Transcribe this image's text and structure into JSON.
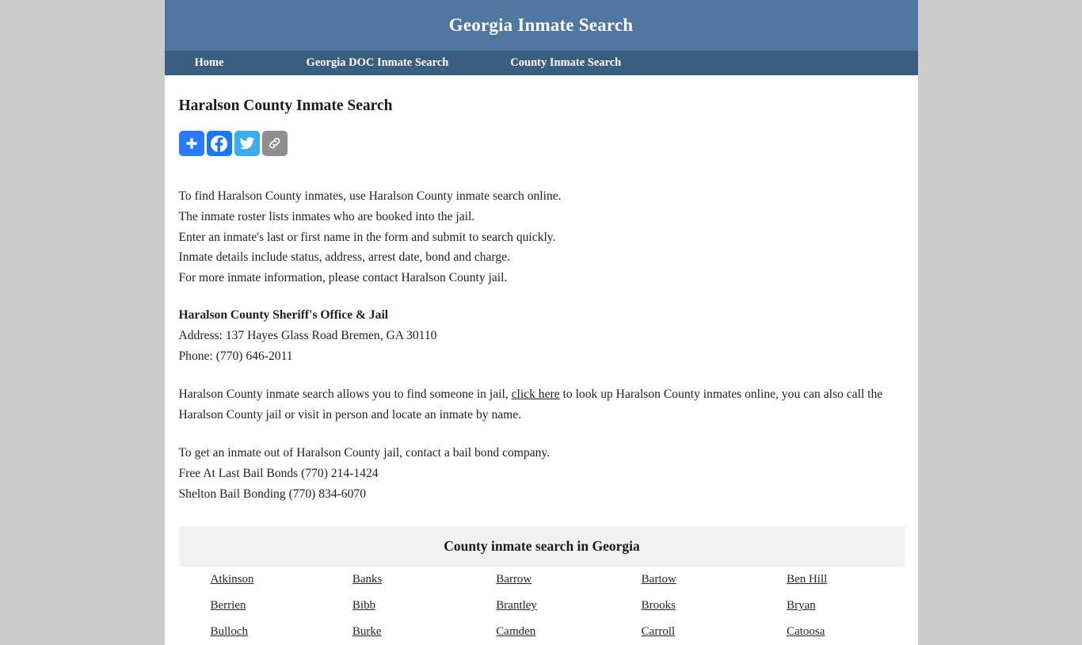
{
  "site": {
    "title": "Georgia Inmate Search",
    "header_bg": "#4f779f",
    "nav_bg": "#3b5e80",
    "page_bg": "#cccccc",
    "content_bg": "#ffffff"
  },
  "nav": {
    "items": [
      {
        "label": "Home"
      },
      {
        "label": "Georgia DOC Inmate Search"
      },
      {
        "label": "County Inmate Search"
      }
    ]
  },
  "main": {
    "page_title": "Haralson County Inmate Search",
    "share": {
      "buttons": [
        {
          "name": "addthis-share-icon",
          "label": "Share",
          "color": "#2a7cf6"
        },
        {
          "name": "facebook-icon",
          "label": "Facebook",
          "color": "#1877f2"
        },
        {
          "name": "twitter-icon",
          "label": "Twitter",
          "color": "#3badeb"
        },
        {
          "name": "copy-link-icon",
          "label": "Copy Link",
          "color": "#8e8e8e"
        }
      ]
    },
    "intro_lines": [
      "To find Haralson County inmates, use Haralson County inmate search online.",
      "The inmate roster lists inmates who are booked into the jail.",
      "Enter an inmate's last or first name in the form and submit to search quickly.",
      "Inmate details include status, address, arrest date, bond and charge.",
      "For more inmate information, please contact Haralson County jail."
    ],
    "contact": {
      "name": "Haralson County Sheriff's Office & Jail",
      "address": "Address: 137 Hayes Glass Road Bremen, GA 30110",
      "phone": "Phone: (770) 646-2011"
    },
    "lookup_paragraph": {
      "before_link": "Haralson County inmate search allows you to find someone in jail, ",
      "link_text": "click here",
      "after_link": " to look up Haralson County inmates online, you can also call the Haralson County jail or visit in person and locate an inmate by name."
    },
    "bail": {
      "intro": "To get an inmate out of Haralson County jail, contact a bail bond company.",
      "companies": [
        "Free At Last Bail Bonds (770) 214-1424",
        "Shelton Bail Bonding (770) 834-6070"
      ]
    },
    "county_table": {
      "caption": "County inmate search in Georgia",
      "rows": [
        [
          "Atkinson",
          "Banks",
          "Barrow",
          "Bartow",
          "Ben Hill"
        ],
        [
          "Berrien",
          "Bibb",
          "Brantley",
          "Brooks",
          "Bryan"
        ],
        [
          "Bulloch",
          "Burke",
          "Camden",
          "Carroll",
          "Catoosa"
        ]
      ]
    }
  }
}
